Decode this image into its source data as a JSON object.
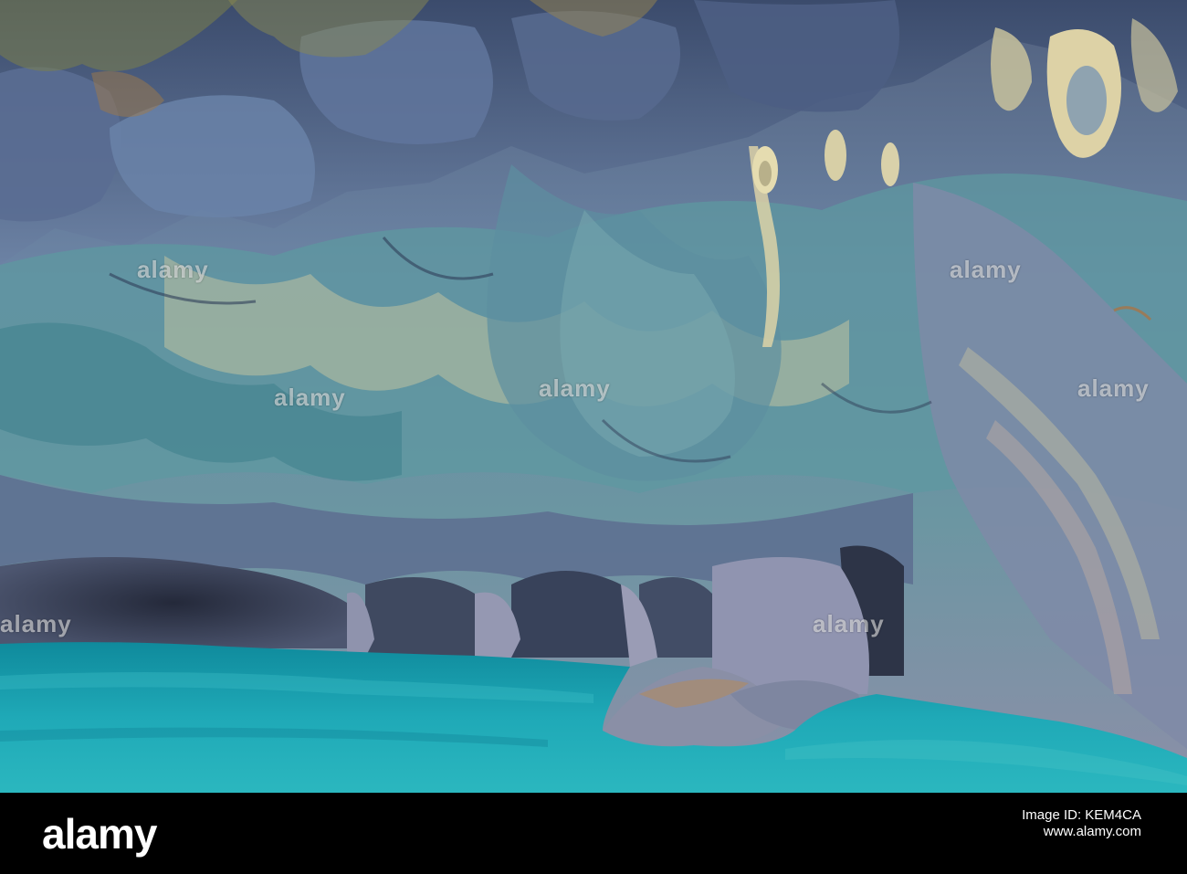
{
  "image": {
    "description_colors": {
      "water": "#1fa6b3",
      "water_deep": "#0f7e8f",
      "rock_blue": "#6f86a8",
      "rock_teal": "#5f9aa0",
      "rock_cream": "#d8cfa4",
      "rock_dark": "#3c4a66",
      "moss": "#9a8a4a"
    }
  },
  "watermarks": {
    "text": "alamy"
  },
  "footer": {
    "logo": "alamy",
    "image_id": "Image ID: KEM4CA",
    "domain": "www.alamy.com"
  }
}
